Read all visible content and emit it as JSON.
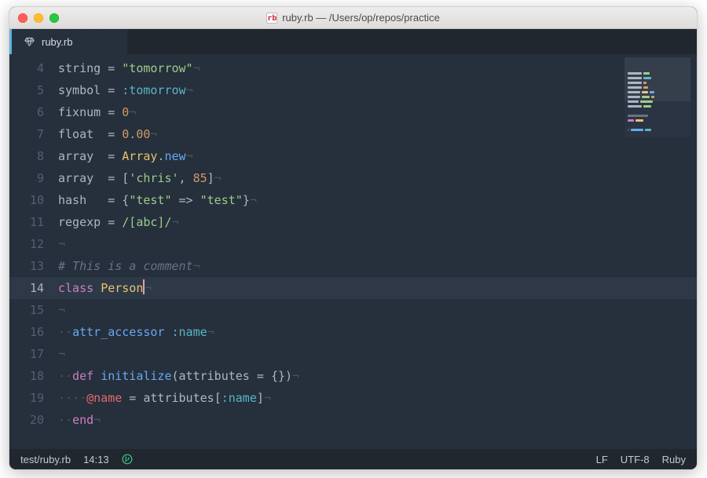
{
  "window": {
    "title": "ruby.rb — /Users/op/repos/practice",
    "file_icon_label": "rb"
  },
  "tab": {
    "title": "ruby.rb"
  },
  "editor": {
    "first_line_number": 4,
    "highlighted_line": 14,
    "lines": [
      {
        "n": 4,
        "tokens": [
          [
            "id",
            "string"
          ],
          [
            "op",
            " = "
          ],
          [
            "str",
            "\"tomorrow\""
          ]
        ]
      },
      {
        "n": 5,
        "tokens": [
          [
            "id",
            "symbol"
          ],
          [
            "op",
            " = "
          ],
          [
            "sym",
            ":tomorrow"
          ]
        ]
      },
      {
        "n": 6,
        "tokens": [
          [
            "id",
            "fixnum"
          ],
          [
            "op",
            " = "
          ],
          [
            "num",
            "0"
          ]
        ]
      },
      {
        "n": 7,
        "tokens": [
          [
            "id",
            "float "
          ],
          [
            "op",
            " = "
          ],
          [
            "num",
            "0.00"
          ]
        ]
      },
      {
        "n": 8,
        "tokens": [
          [
            "id",
            "array "
          ],
          [
            "op",
            " = "
          ],
          [
            "cls",
            "Array"
          ],
          [
            "pu",
            "."
          ],
          [
            "fn",
            "new"
          ]
        ]
      },
      {
        "n": 9,
        "tokens": [
          [
            "id",
            "array "
          ],
          [
            "op",
            " = "
          ],
          [
            "pu",
            "["
          ],
          [
            "str",
            "'chris'"
          ],
          [
            "pu",
            ", "
          ],
          [
            "num",
            "85"
          ],
          [
            "pu",
            "]"
          ]
        ]
      },
      {
        "n": 10,
        "tokens": [
          [
            "id",
            "hash  "
          ],
          [
            "op",
            " = "
          ],
          [
            "pu",
            "{"
          ],
          [
            "str",
            "\"test\""
          ],
          [
            "op",
            " => "
          ],
          [
            "str",
            "\"test\""
          ],
          [
            "pu",
            "}"
          ]
        ]
      },
      {
        "n": 11,
        "tokens": [
          [
            "id",
            "regexp"
          ],
          [
            "op",
            " = "
          ],
          [
            "str",
            "/[abc]/"
          ]
        ]
      },
      {
        "n": 12,
        "tokens": []
      },
      {
        "n": 13,
        "tokens": [
          [
            "com",
            "# This is a comment"
          ]
        ]
      },
      {
        "n": 14,
        "tokens": [
          [
            "kw",
            "class"
          ],
          [
            "id",
            " "
          ],
          [
            "cls",
            "Person"
          ]
        ],
        "cursor_after": true
      },
      {
        "n": 15,
        "tokens": []
      },
      {
        "n": 16,
        "tokens": [
          [
            "inv",
            "··"
          ],
          [
            "fn",
            "attr_accessor"
          ],
          [
            "id",
            " "
          ],
          [
            "sym",
            ":name"
          ]
        ]
      },
      {
        "n": 17,
        "tokens": []
      },
      {
        "n": 18,
        "tokens": [
          [
            "inv",
            "··"
          ],
          [
            "kw",
            "def"
          ],
          [
            "id",
            " "
          ],
          [
            "fn",
            "initialize"
          ],
          [
            "pu",
            "("
          ],
          [
            "id",
            "attributes"
          ],
          [
            "op",
            " = "
          ],
          [
            "pu",
            "{})"
          ]
        ]
      },
      {
        "n": 19,
        "tokens": [
          [
            "inv",
            "····"
          ],
          [
            "iv",
            "@name"
          ],
          [
            "op",
            " = "
          ],
          [
            "id",
            "attributes"
          ],
          [
            "pu",
            "["
          ],
          [
            "sym",
            ":name"
          ],
          [
            "pu",
            "]"
          ]
        ]
      },
      {
        "n": 20,
        "tokens": [
          [
            "inv",
            "··"
          ],
          [
            "kw",
            "end"
          ]
        ]
      }
    ],
    "invisible_nl_glyph": "¬",
    "invisible_dot_glyph": "·"
  },
  "status": {
    "path": "test/ruby.rb",
    "cursor": "14:13",
    "line_ending": "LF",
    "encoding": "UTF-8",
    "language": "Ruby"
  },
  "colors": {
    "keyword": "#cc7fbf",
    "def": "#65aaf0",
    "class": "#e6c46c",
    "string": "#9dcc8a",
    "number": "#d19a66",
    "symbol": "#58b6c2",
    "comment": "#687485"
  }
}
